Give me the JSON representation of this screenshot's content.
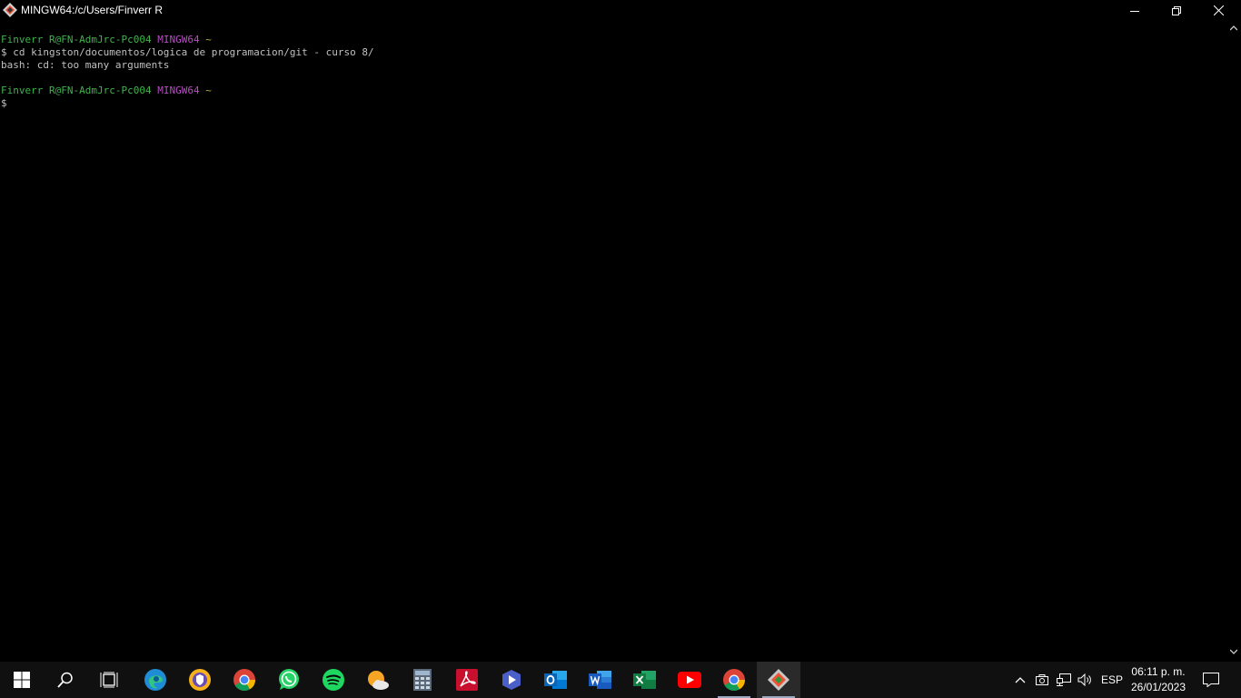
{
  "window": {
    "title": "MINGW64:/c/Users/Finverr R"
  },
  "terminal": {
    "prompt1": {
      "user": "Finverr R@FN-AdmJrc-Pc004",
      "env": "MINGW64",
      "path": "~"
    },
    "command1": "$ cd kingston/documentos/logica de programacion/git - curso 8/",
    "output1": "bash: cd: too many arguments",
    "prompt2": {
      "user": "Finverr R@FN-AdmJrc-Pc004",
      "env": "MINGW64",
      "path": "~"
    },
    "command2": "$ "
  },
  "taskbar": {
    "apps": [
      "start-icon",
      "search-icon",
      "task-view-icon",
      "edge-icon",
      "vpn-icon",
      "chrome-icon",
      "whatsapp-icon",
      "spotify-icon",
      "weather-icon",
      "calculator-icon",
      "acrobat-icon",
      "video-editor-icon",
      "outlook-icon",
      "word-icon",
      "excel-icon",
      "youtube-icon",
      "chrome-icon",
      "git-bash-icon"
    ],
    "language": "ESP",
    "time": "06:11 p. m.",
    "date": "26/01/2023"
  },
  "colors": {
    "prompt_user": "#3cb54a",
    "prompt_env": "#b84cc4",
    "prompt_path": "#b4ad36",
    "terminal_text": "#c0c0c0",
    "background": "#000000"
  }
}
